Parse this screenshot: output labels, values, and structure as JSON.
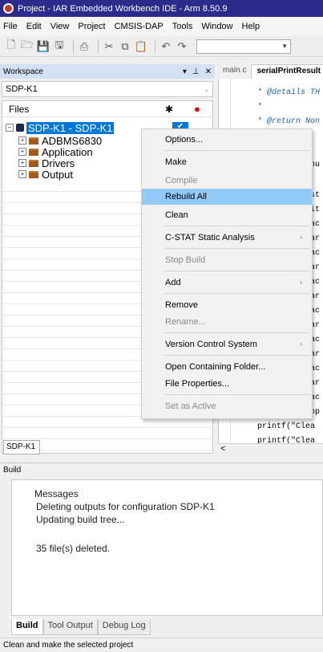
{
  "window": {
    "title": "Project - IAR Embedded Workbench IDE - Arm 8.50.9"
  },
  "menubar": [
    "File",
    "Edit",
    "View",
    "Project",
    "CMSIS-DAP",
    "Tools",
    "Window",
    "Help"
  ],
  "workspace": {
    "header": "Workspace",
    "selector_value": "SDP-K1",
    "files_label": "Files",
    "tree": {
      "root": "SDP-K1 - SDP-K1",
      "children": [
        "ADBMS6830",
        "Application",
        "Drivers",
        "Output"
      ]
    },
    "bottom_tab": "SDP-K1"
  },
  "editor": {
    "tabs": [
      "main.c",
      "serialPrintResult"
    ],
    "lines": [
      {
        "text": "* @details TH",
        "type": "comment"
      },
      {
        "text": "*",
        "type": "comment"
      },
      {
        "text": "* @return Non",
        "type": "comment"
      },
      {
        "text": "*",
        "type": "comment"
      },
      {
        "text": "nu",
        "type": "code"
      },
      {
        "text": "st",
        "type": "code"
      },
      {
        "text": "it",
        "type": "code"
      },
      {
        "text": "ac",
        "type": "code"
      },
      {
        "text": "ar",
        "type": "code"
      },
      {
        "text": "ac",
        "type": "code"
      },
      {
        "text": "ar",
        "type": "code"
      },
      {
        "text": "ac",
        "type": "code"
      },
      {
        "text": "ar",
        "type": "code"
      },
      {
        "text": "ac",
        "type": "code"
      },
      {
        "text": "ar",
        "type": "code"
      },
      {
        "text": "ac",
        "type": "code"
      },
      {
        "text": "ar",
        "type": "code"
      },
      {
        "text": "ac",
        "type": "code"
      },
      {
        "text": "ar",
        "type": "code"
      },
      {
        "text": "ac",
        "type": "code"
      },
      {
        "text": "op",
        "type": "code"
      },
      {
        "text": "printf(\"Clea",
        "type": "code"
      },
      {
        "text": "printf(\"Clea",
        "type": "code"
      }
    ]
  },
  "context_menu": {
    "items": [
      {
        "label": "Options...",
        "disabled": false,
        "submenu": false,
        "highlight": false
      },
      {
        "label": "Make",
        "disabled": false,
        "submenu": false,
        "highlight": false
      },
      {
        "label": "Compile",
        "disabled": true,
        "submenu": false,
        "highlight": false
      },
      {
        "label": "Rebuild All",
        "disabled": false,
        "submenu": false,
        "highlight": true
      },
      {
        "label": "Clean",
        "disabled": false,
        "submenu": false,
        "highlight": false
      },
      {
        "label": "C-STAT Static Analysis",
        "disabled": false,
        "submenu": true,
        "highlight": false
      },
      {
        "label": "Stop Build",
        "disabled": true,
        "submenu": false,
        "highlight": false
      },
      {
        "label": "Add",
        "disabled": false,
        "submenu": true,
        "highlight": false
      },
      {
        "label": "Remove",
        "disabled": false,
        "submenu": false,
        "highlight": false
      },
      {
        "label": "Rename...",
        "disabled": true,
        "submenu": false,
        "highlight": false
      },
      {
        "label": "Version Control System",
        "disabled": false,
        "submenu": true,
        "highlight": false
      },
      {
        "label": "Open Containing Folder...",
        "disabled": false,
        "submenu": false,
        "highlight": false
      },
      {
        "label": "File Properties...",
        "disabled": false,
        "submenu": false,
        "highlight": false
      },
      {
        "label": "Set as Active",
        "disabled": true,
        "submenu": false,
        "highlight": false
      }
    ]
  },
  "build": {
    "header": "Build",
    "messages_label": "Messages",
    "messages": [
      "Deleting outputs for configuration SDP-K1",
      "Updating build tree...",
      "",
      "35 file(s) deleted."
    ],
    "tabs": [
      "Build",
      "Tool Output",
      "Debug Log"
    ]
  },
  "statusbar": {
    "text": "Clean and make the selected project"
  }
}
